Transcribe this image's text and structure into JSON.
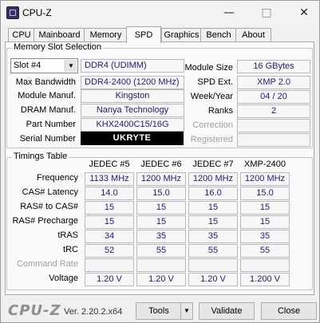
{
  "window": {
    "title": "CPU-Z"
  },
  "tabs": [
    "CPU",
    "Mainboard",
    "Memory",
    "SPD",
    "Graphics",
    "Bench",
    "About"
  ],
  "memory_slot": {
    "group_title": "Memory Slot Selection",
    "slot_selected": "Slot #4",
    "module_type": "DDR4 (UDIMM)",
    "max_bandwidth_label": "Max Bandwidth",
    "max_bandwidth": "DDR4-2400 (1200 MHz)",
    "module_manuf_label": "Module Manuf.",
    "module_manuf": "Kingston",
    "dram_manuf_label": "DRAM Manuf.",
    "dram_manuf": "Nanya Technology",
    "part_number_label": "Part Number",
    "part_number": "KHX2400C15/16G",
    "serial_number_label": "Serial Number",
    "serial_number": "UKRYTE",
    "module_size_label": "Module Size",
    "module_size": "16 GBytes",
    "spd_ext_label": "SPD Ext.",
    "spd_ext": "XMP 2.0",
    "week_year_label": "Week/Year",
    "week_year": "04 / 20",
    "ranks_label": "Ranks",
    "ranks": "2",
    "correction_label": "Correction",
    "correction": "",
    "registered_label": "Registered",
    "registered": ""
  },
  "timings": {
    "group_title": "Timings Table",
    "columns": [
      "JEDEC #5",
      "JEDEC #6",
      "JEDEC #7",
      "XMP-2400"
    ],
    "rows": [
      {
        "label": "Frequency",
        "values": [
          "1133 MHz",
          "1200 MHz",
          "1200 MHz",
          "1200 MHz"
        ]
      },
      {
        "label": "CAS# Latency",
        "values": [
          "14.0",
          "15.0",
          "16.0",
          "15.0"
        ]
      },
      {
        "label": "RAS# to CAS#",
        "values": [
          "15",
          "15",
          "15",
          "15"
        ]
      },
      {
        "label": "RAS# Precharge",
        "values": [
          "15",
          "15",
          "15",
          "15"
        ]
      },
      {
        "label": "tRAS",
        "values": [
          "34",
          "35",
          "35",
          "35"
        ]
      },
      {
        "label": "tRC",
        "values": [
          "52",
          "55",
          "55",
          "55"
        ]
      },
      {
        "label": "Command Rate",
        "values": [
          "",
          "",
          "",
          ""
        ]
      },
      {
        "label": "Voltage",
        "values": [
          "1.20 V",
          "1.20 V",
          "1.20 V",
          "1.200 V"
        ]
      }
    ]
  },
  "footer": {
    "logo": "CPU-Z",
    "version": "Ver. 2.20.2.x64",
    "tools_label": "Tools",
    "validate_label": "Validate",
    "close_label": "Close"
  }
}
